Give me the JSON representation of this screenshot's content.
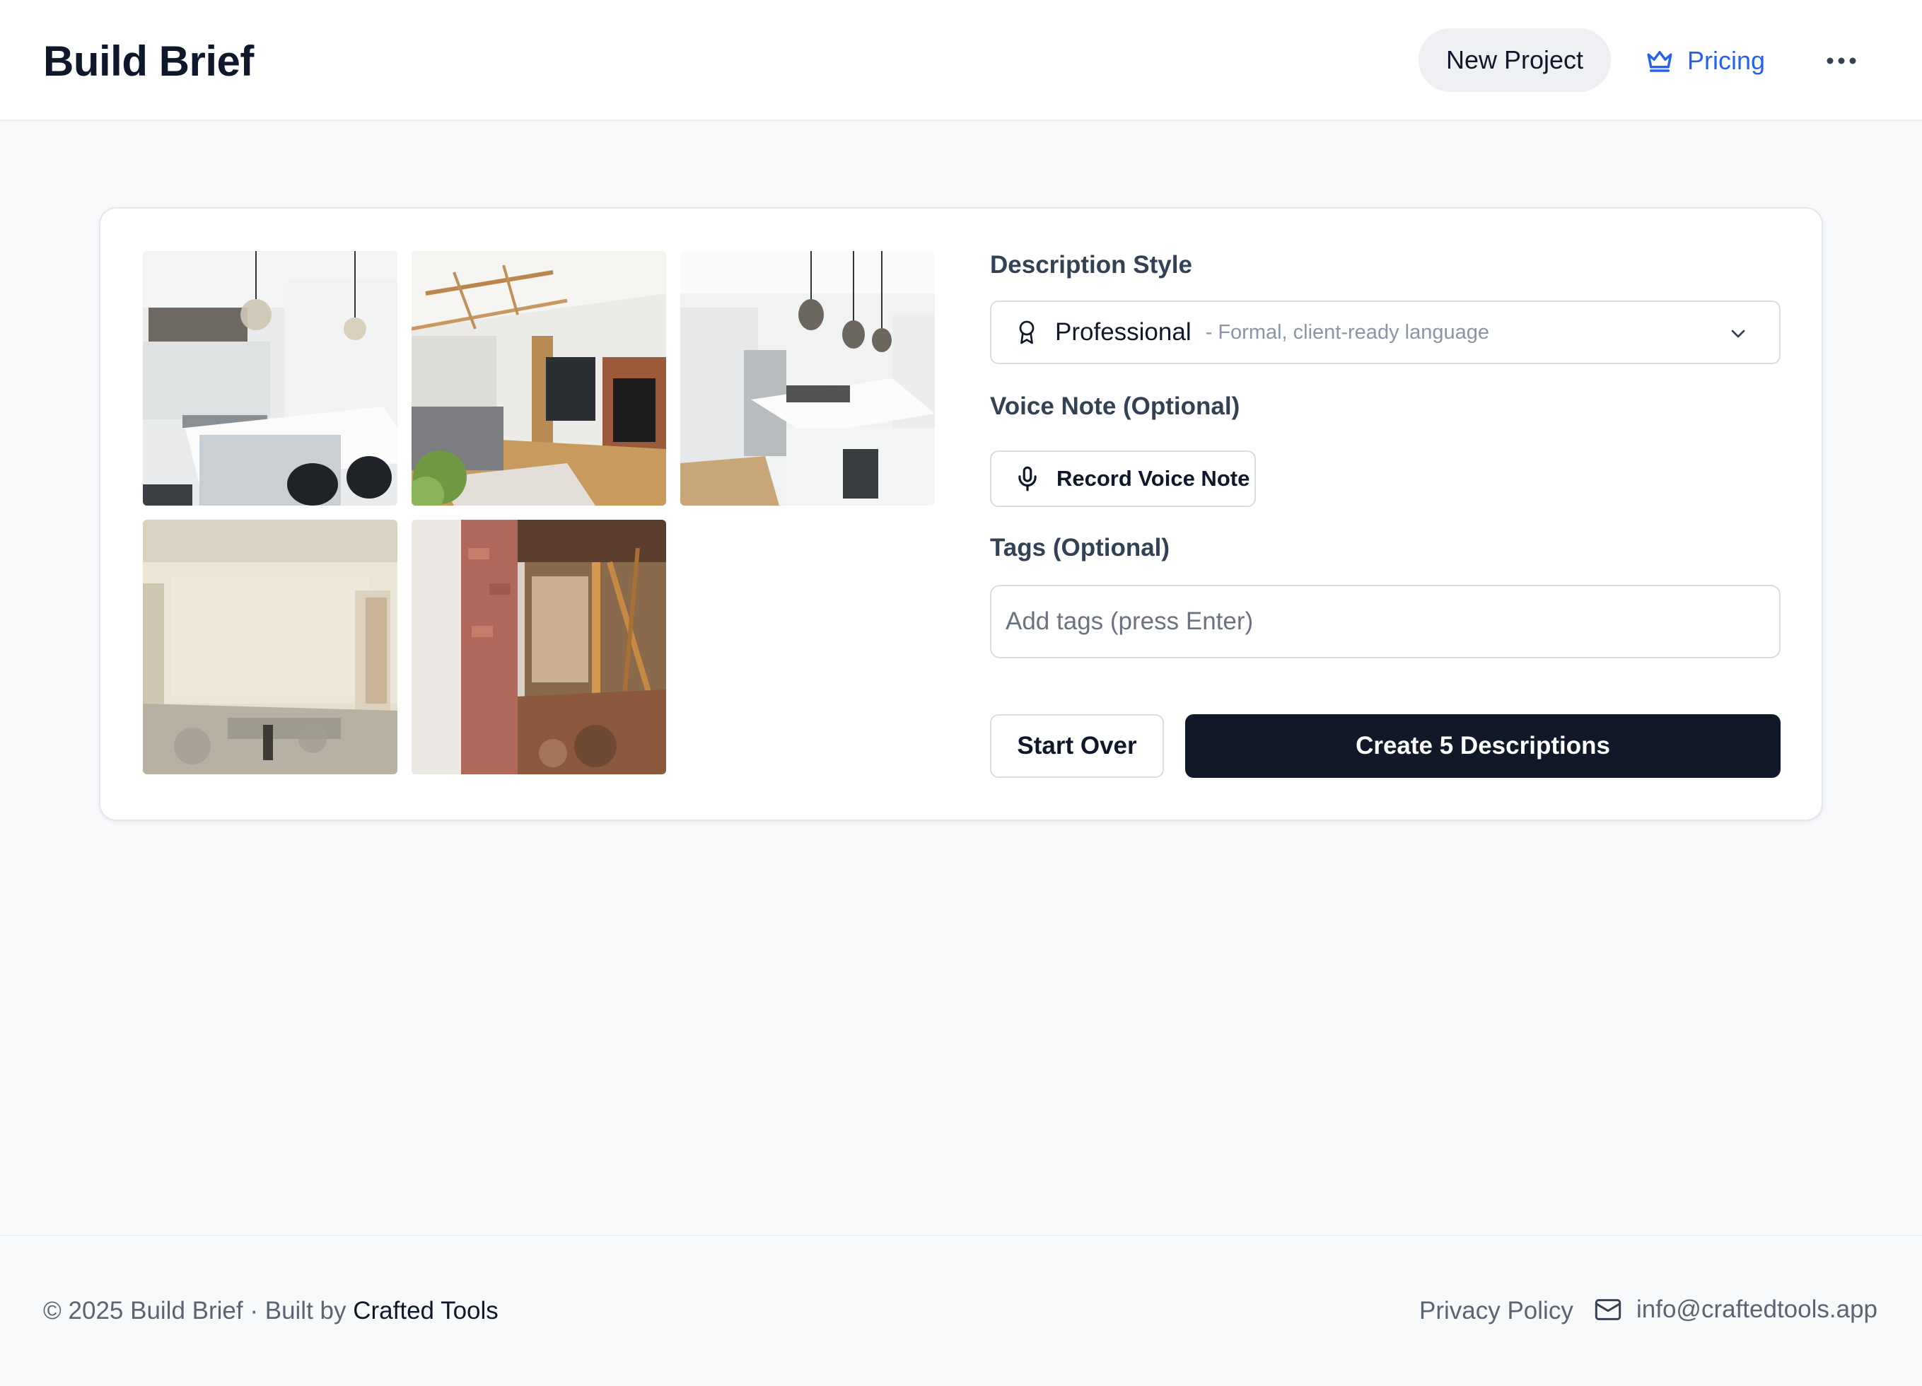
{
  "header": {
    "brand": "Build Brief",
    "new_project_label": "New Project",
    "pricing_label": "Pricing",
    "pricing_icon": "crown-icon",
    "more_icon": "more-horizontal-icon"
  },
  "gallery": {
    "images": [
      {
        "name": "kitchen-photo-1",
        "desc": "white kitchen with island and pendant lights"
      },
      {
        "name": "living-room-photo",
        "desc": "living room with fireplace and exposed beams"
      },
      {
        "name": "kitchen-photo-2",
        "desc": "white kitchen island with pendant lights"
      },
      {
        "name": "demolition-room-photo",
        "desc": "gutted room under demolition"
      },
      {
        "name": "demolition-wall-photo",
        "desc": "wall opening with exposed brick and framing"
      }
    ]
  },
  "form": {
    "style_label": "Description Style",
    "style_value": "Professional",
    "style_hint": "- Formal, client-ready language",
    "style_icon": "award-icon",
    "voice_label": "Voice Note (Optional)",
    "voice_button": "Record Voice Note",
    "voice_icon": "microphone-icon",
    "tags_label": "Tags (Optional)",
    "tags_placeholder": "Add tags (press Enter)",
    "tags_value": "",
    "start_over": "Start Over",
    "create": "Create 5 Descriptions"
  },
  "footer": {
    "copyright": "© 2025 Build Brief · Built by ",
    "maker": "Crafted Tools",
    "privacy": "Privacy Policy",
    "email": "info@craftedtools.app",
    "email_icon": "mail-icon"
  },
  "colors": {
    "accent": "#2563eb",
    "primary_button": "#111827",
    "background": "#f8f9fb"
  }
}
